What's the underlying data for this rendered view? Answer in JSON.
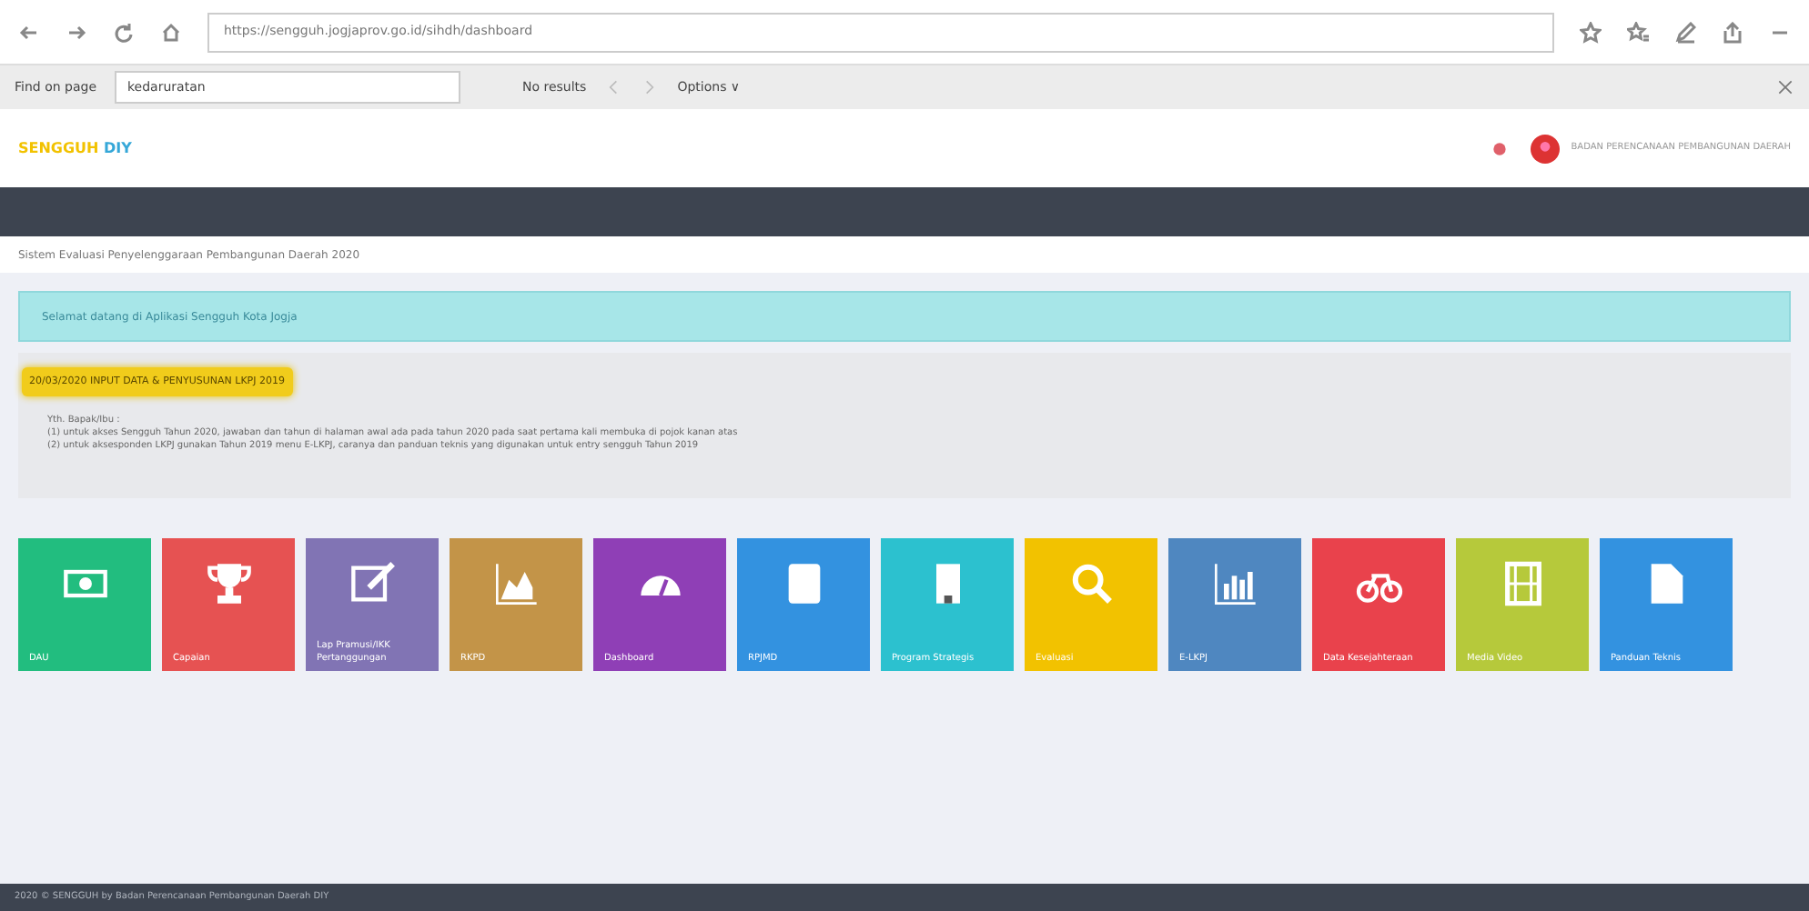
{
  "browser": {
    "url": "https://sengguh.jogjaprov.go.id/sihdh/dashboard",
    "find": {
      "label": "Find on page",
      "value": "kedaruratan",
      "result": "No results",
      "options": "Options ∨"
    }
  },
  "header": {
    "logo_a": "SENGGUH",
    "logo_b": "DIY",
    "user": "BADAN PERENCANAAN PEMBANGUNAN DAERAH"
  },
  "page_title": "Sistem Evaluasi Penyelenggaraan Pembangunan Daerah 2020",
  "alert": "Selamat datang di Aplikasi Sengguh Kota Jogja",
  "notice": {
    "badge": "20/03/2020 INPUT DATA & PENYUSUNAN LKPJ 2019",
    "greeting": "Yth. Bapak/Ibu :",
    "lines": [
      "(1) untuk akses Sengguh Tahun 2020, jawaban dan tahun di halaman awal ada pada tahun 2020 pada saat pertama kali membuka di pojok kanan atas",
      "(2) untuk aksesponden LKPJ gunakan Tahun 2019 menu E-LKPJ, caranya dan panduan teknis yang digunakan untuk entry sengguh Tahun 2019"
    ]
  },
  "tiles": [
    {
      "label": "DAU",
      "color": "#22bd7f"
    },
    {
      "label": "Capaian",
      "color": "#e65252"
    },
    {
      "label": "Lap Pramusi/IKK Pertanggungan",
      "color": "#8174b4"
    },
    {
      "label": "RKPD",
      "color": "#c39448"
    },
    {
      "label": "Dashboard",
      "color": "#8f3fb6"
    },
    {
      "label": "RPJMD",
      "color": "#3392e0"
    },
    {
      "label": "Program Strategis",
      "color": "#2cc1cf"
    },
    {
      "label": "Evaluasi",
      "color": "#f2c200"
    },
    {
      "label": "E-LKPJ",
      "color": "#4f87c0"
    },
    {
      "label": "Data Kesejahteraan",
      "color": "#e9424c"
    },
    {
      "label": "Media Video",
      "color": "#b6c93b"
    },
    {
      "label": "Panduan Teknis",
      "color": "#3392e0"
    }
  ],
  "footer": "2020 © SENGGUH by Badan Perencanaan Pembangunan Daerah DIY"
}
